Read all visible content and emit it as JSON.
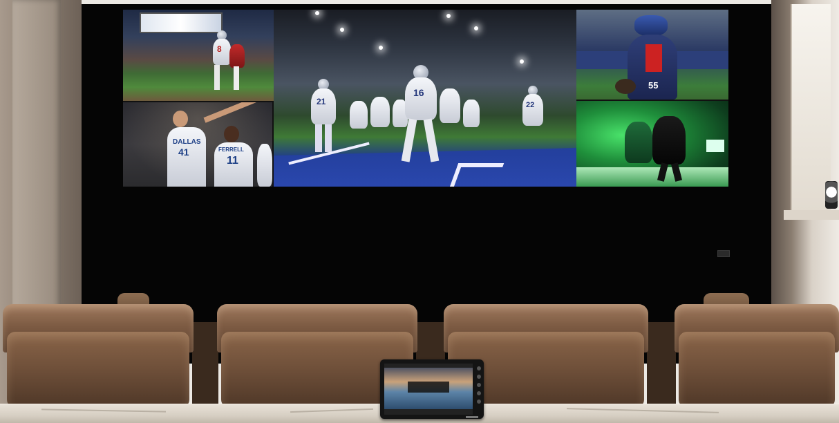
{
  "scene": {
    "description_colors": {
      "wall": "#050505",
      "leather": "#7d5b43",
      "counter": "#d6cec2"
    }
  },
  "videowall": {
    "tiles": [
      {
        "id": "football-catch-tile",
        "jersey_text": "8"
      },
      {
        "id": "basketball-tile",
        "jersey_text_1": "DALLAS",
        "jersey_number_1": "41",
        "jersey_text_2": "FERRELL",
        "jersey_number_2": "11"
      },
      {
        "id": "football-team-tile",
        "jersey_number_1": "21",
        "jersey_number_2": "16",
        "jersey_number_3": "22"
      },
      {
        "id": "baseball-catcher-tile",
        "jersey_number": "55"
      },
      {
        "id": "hockey-tile"
      }
    ]
  }
}
